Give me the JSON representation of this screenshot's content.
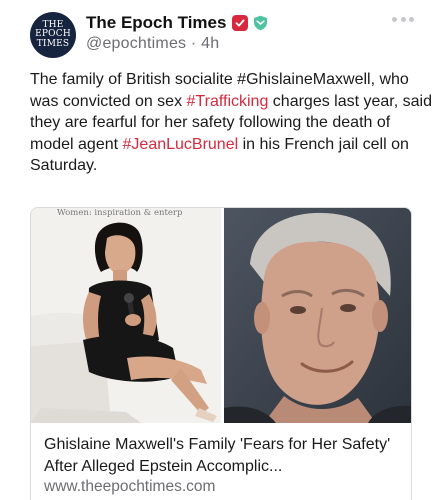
{
  "account": {
    "avatar_lines": [
      "THE",
      "EPOCH",
      "TIMES"
    ],
    "name": "The Epoch Times",
    "handle": "@epochtimes",
    "separator": " · ",
    "time_ago": "4h"
  },
  "post": {
    "segments": [
      {
        "text": "The family of British socialite #GhislaineMaxwell, who was convicted on sex ",
        "hashtag": false
      },
      {
        "text": "#Trafficking",
        "hashtag": true
      },
      {
        "text": " charges last year, said they are fearful for her safety following the death of model agent ",
        "hashtag": false
      },
      {
        "text": "#JeanLucBrunel",
        "hashtag": true
      },
      {
        "text": " in his French jail cell on Saturday.",
        "hashtag": false
      }
    ]
  },
  "link_card": {
    "backdrop_text": "Women: inspiration & enterp",
    "title": "Ghislaine Maxwell's Family 'Fears for Her Safety' After Alleged Epstein Accomplic...",
    "url": "www.theepochtimes.com"
  },
  "colors": {
    "accent": "#d6293e",
    "muted": "#6d6d72",
    "avatar_bg": "#16243f",
    "shield": "#4ec3a1"
  },
  "icons": {
    "verified": "check-badge-icon",
    "shield": "shield-icon",
    "more": "more-options-icon"
  }
}
